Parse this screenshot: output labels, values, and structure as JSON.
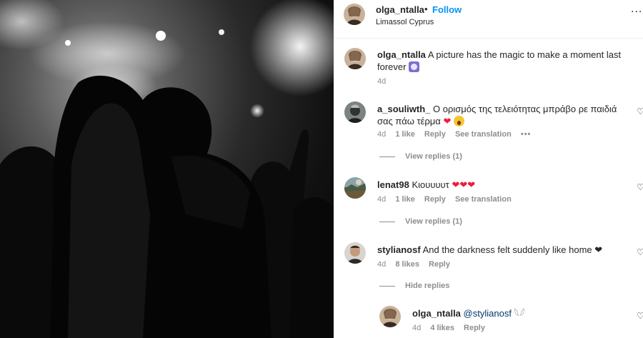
{
  "header": {
    "username": "olga_ntalla",
    "dot": "•",
    "follow_label": "Follow",
    "location": "Limassol Cyprus",
    "more": "..."
  },
  "caption": {
    "username": "olga_ntalla",
    "text": "A picture has the magic to make a moment last forever",
    "time": "4d"
  },
  "comments": [
    {
      "username": "a_souliwth_",
      "text": "Ο ορισμός της τελειότητας μπράβο ρε παιδιά σας πάω τέρμα",
      "emoji": "❤",
      "time": "4d",
      "likes": "1 like",
      "reply": "Reply",
      "translate": "See translation",
      "more": "•••",
      "view_replies": "View replies (1)"
    },
    {
      "username": "lenat98",
      "text": "Κιουυυυτ",
      "emoji": "❤❤❤",
      "time": "4d",
      "likes": "1 like",
      "reply": "Reply",
      "translate": "See translation",
      "view_replies": "View replies (1)"
    },
    {
      "username": "stylianosf",
      "text": "And the darkness felt suddenly like home",
      "emoji": "❤",
      "time": "4d",
      "likes": "8 likes",
      "reply": "Reply",
      "hide_replies": "Hide replies"
    }
  ],
  "reply": {
    "username": "olga_ntalla",
    "mention": "@stylianosf",
    "emoji": "𓆩𓆪",
    "time": "4d",
    "likes": "4 likes",
    "reply": "Reply"
  },
  "heart_icon": "♡",
  "colors": {
    "follow": "#0095f6",
    "text": "#262626",
    "muted": "#8e8e8e",
    "heart": "#ed1c3c",
    "mention": "#00376b"
  }
}
